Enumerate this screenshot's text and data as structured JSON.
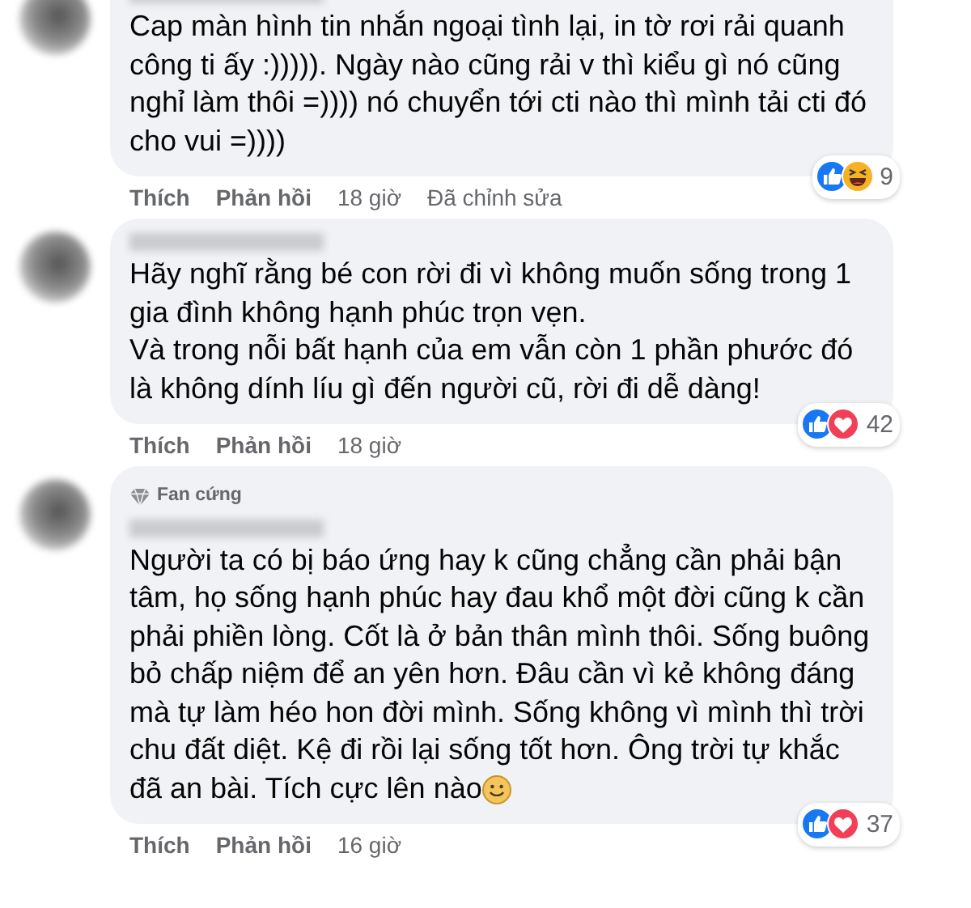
{
  "comments": [
    {
      "text": "Cap màn hình tin nhắn ngoại tình lại, in tờ rơi rải quanh công ti ấy :))))). Ngày nào cũng rải v thì kiểu gì nó cũng nghỉ làm thôi =)))) nó chuyển tới cti nào thì mình tải cti đó cho vui =))))",
      "reactions": [
        {
          "kind": "like"
        },
        {
          "kind": "haha"
        }
      ],
      "reaction_count": "9",
      "actions": [
        "Thích",
        "Phản hồi"
      ],
      "time": "18 giờ",
      "edited": "Đã chỉnh sửa"
    },
    {
      "text": "Hãy nghĩ rằng bé con rời đi vì không muốn sống trong 1 gia đình không hạnh phúc trọn vẹn.\nVà trong nỗi bất hạnh của em vẫn còn 1 phần phước đó là không dính líu gì đến người cũ, rời đi dễ dàng!",
      "reactions": [
        {
          "kind": "like"
        },
        {
          "kind": "love"
        }
      ],
      "reaction_count": "42",
      "actions": [
        "Thích",
        "Phản hồi"
      ],
      "time": "18 giờ"
    },
    {
      "badge": "Fan cứng",
      "text": "Người ta có bị báo ứng hay k cũng chẳng cần phải bận tâm, họ sống hạnh phúc hay đau khổ một đời cũng k cần phải phiền lòng. Cốt là ở bản thân mình thôi. Sống buông bỏ chấp niệm để an yên hơn. Đâu cần vì kẻ không đáng mà tự làm héo hon đời mình. Sống không vì mình thì trời chu đất diệt. Kệ đi rồi lại sống tốt hơn. Ông trời tự khắc đã an bài. Tích cực lên nào",
      "emoji": true,
      "reactions": [
        {
          "kind": "like"
        },
        {
          "kind": "love"
        }
      ],
      "reaction_count": "37",
      "actions": [
        "Thích",
        "Phản hồi"
      ],
      "time": "16 giờ"
    }
  ]
}
